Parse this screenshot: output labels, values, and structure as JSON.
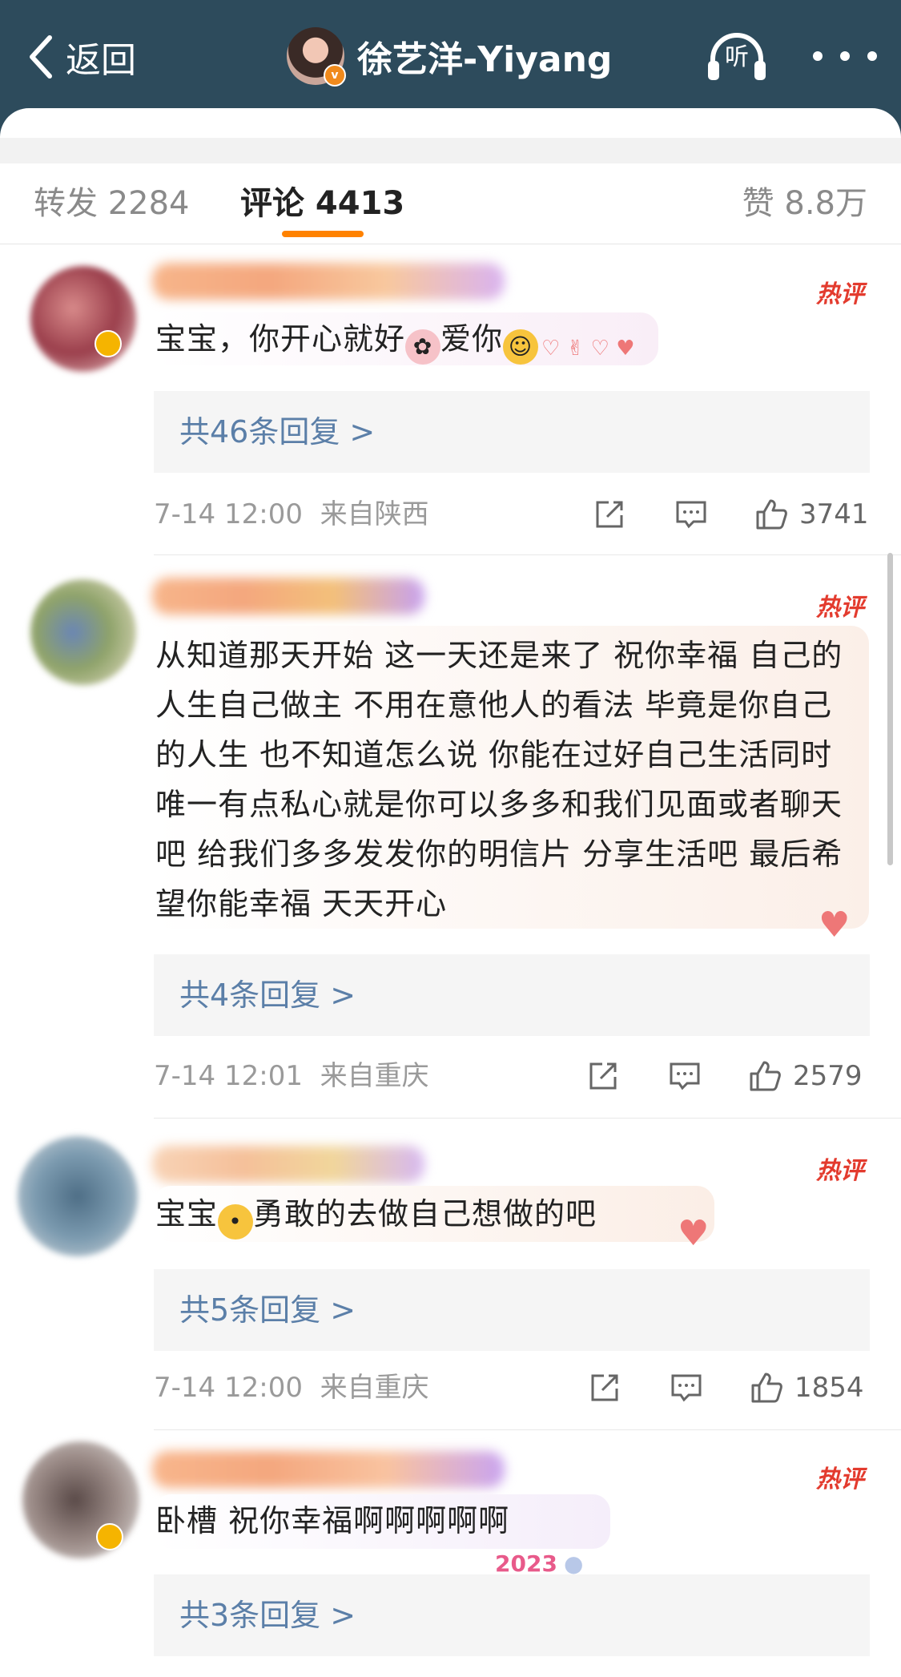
{
  "nav": {
    "back_label": "返回",
    "title": "徐艺洋-Yiyang",
    "listen_label": "听"
  },
  "tabs": {
    "forward": "转发 2284",
    "comments": "评论 4413",
    "likes": "赞 8.8万"
  },
  "colors": {
    "nav_bg": "#2d4b5c",
    "accent": "#ff8200",
    "hot_badge": "#e33b2e",
    "reply_link": "#5b7fa8"
  },
  "comments": [
    {
      "badge": "热评",
      "text": "宝宝，你开心就好🙂爱你😘",
      "text_before": "宝宝，你开心就好",
      "text_mid": "爱你",
      "replies": "共46条回复 >",
      "time": "7-14 12:00",
      "location": "来自陕西",
      "likes": "3741"
    },
    {
      "badge": "热评",
      "text": "从知道那天开始 这一天还是来了 祝你幸福 自己的人生自己做主 不用在意他人的看法 毕竟是你自己的人生 也不知道怎么说 你能在过好自己生活同时 唯一有点私心就是你可以多多和我们见面或者聊天吧 给我们多多发发你的明信片 分享生活吧 最后希望你能幸福 天天开心",
      "replies": "共4条回复 >",
      "time": "7-14 12:01",
      "location": "来自重庆",
      "likes": "2579"
    },
    {
      "badge": "热评",
      "text_before": "宝宝",
      "text_after": "勇敢的去做自己想做的吧",
      "replies": "共5条回复 >",
      "time": "7-14 12:00",
      "location": "来自重庆",
      "likes": "1854"
    },
    {
      "badge": "热评",
      "text": "卧槽 祝你幸福啊啊啊啊啊",
      "sticker_text": "2023",
      "replies": "共3条回复 >"
    }
  ],
  "icons": [
    "back-chevron-icon",
    "listen-headphones-icon",
    "more-dots-icon",
    "share-icon",
    "comment-icon",
    "like-icon"
  ]
}
